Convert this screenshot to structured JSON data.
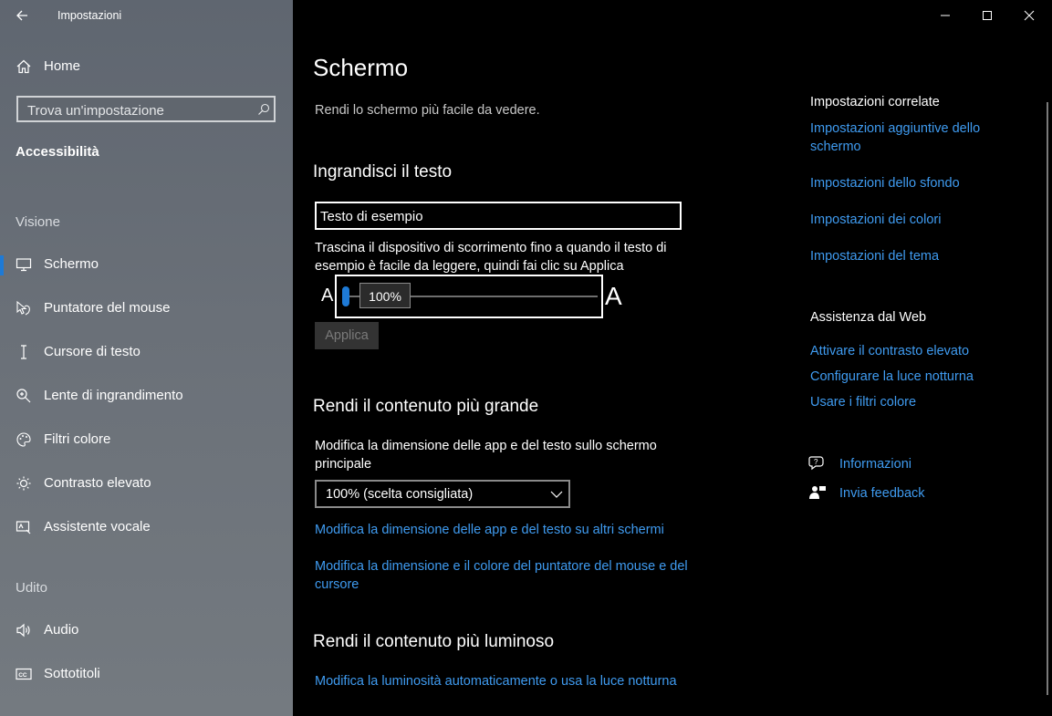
{
  "window": {
    "title": "Impostazioni"
  },
  "sidebar": {
    "home": "Home",
    "search_placeholder": "Trova un'impostazione",
    "category": "Accessibilità",
    "groups": [
      {
        "title": "Visione",
        "items": [
          {
            "label": "Schermo",
            "icon": "monitor-icon",
            "selected": true
          },
          {
            "label": "Puntatore del mouse",
            "icon": "mouse-pointer-icon"
          },
          {
            "label": "Cursore di testo",
            "icon": "text-cursor-icon"
          },
          {
            "label": "Lente di ingrandimento",
            "icon": "magnifier-icon"
          },
          {
            "label": "Filtri colore",
            "icon": "color-palette-icon"
          },
          {
            "label": "Contrasto elevato",
            "icon": "brightness-icon"
          },
          {
            "label": "Assistente vocale",
            "icon": "narrator-icon"
          }
        ]
      },
      {
        "title": "Udito",
        "items": [
          {
            "label": "Audio",
            "icon": "speaker-icon"
          },
          {
            "label": "Sottotitoli",
            "icon": "closed-captions-icon"
          }
        ]
      }
    ]
  },
  "main": {
    "title": "Schermo",
    "subtitle": "Rendi lo schermo più facile da vedere.",
    "enlarge_text": {
      "heading": "Ingrandisci il testo",
      "sample": "Testo di esempio",
      "instructions": "Trascina il dispositivo di scorrimento fino a quando il testo di esempio è facile da leggere, quindi fai clic su Applica",
      "slider_min_label": "A",
      "slider_max_label": "A",
      "slider_value": "100%",
      "slider_fraction": 0.0,
      "apply_label": "Applica"
    },
    "bigger": {
      "heading": "Rendi il contenuto più grande",
      "description": "Modifica la dimensione delle app e del testo sullo schermo principale",
      "dropdown_value": "100% (scelta consigliata)",
      "link1": "Modifica la dimensione delle app e del testo su altri schermi",
      "link2": "Modifica la dimensione e il colore del puntatore del mouse e del cursore"
    },
    "brighter": {
      "heading": "Rendi il contenuto più luminoso",
      "link": "Modifica la luminosità automaticamente o usa la luce notturna"
    }
  },
  "right": {
    "related_title": "Impostazioni correlate",
    "related_links": [
      "Impostazioni aggiuntive dello schermo",
      "Impostazioni dello sfondo",
      "Impostazioni dei colori",
      "Impostazioni del tema"
    ],
    "web_title": "Assistenza dal Web",
    "web_links": [
      "Attivare il contrasto elevato",
      "Configurare la luce notturna",
      "Usare i filtri colore"
    ],
    "info_label": "Informazioni",
    "feedback_label": "Invia feedback"
  },
  "colors": {
    "accent": "#1e7ad6",
    "link": "#3f9bf0"
  }
}
